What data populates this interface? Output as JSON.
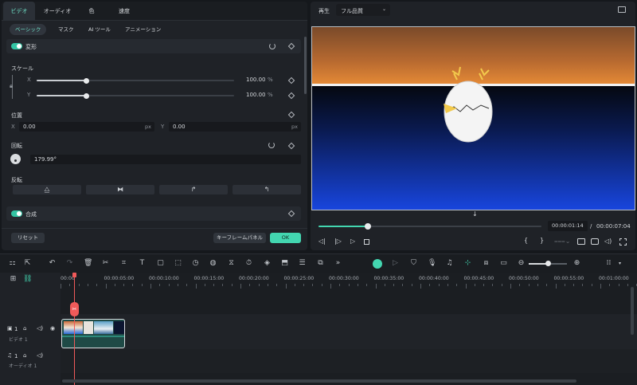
{
  "colors": {
    "accent": "#43d6b0",
    "playhead": "#f05a5a",
    "sky_top": "#7a4a2a",
    "sky_bottom": "#e58a36",
    "sea_top": "#050810",
    "sea_bottom": "#1846e0"
  },
  "left_panel": {
    "tabs": [
      "ビデオ",
      "オーディオ",
      "色",
      "速度"
    ],
    "active_tab": "ビデオ",
    "subtabs": [
      "ベーシック",
      "マスク",
      "AI ツール",
      "アニメーション"
    ],
    "active_subtab": "ベーシック",
    "transform": {
      "title": "変形",
      "scale_label": "スケール",
      "x_axis": "X",
      "y_axis": "Y",
      "scale_x": "100.00",
      "scale_y": "100.00",
      "percent": "%",
      "scale_x_level": 0.25,
      "scale_y_level": 0.25
    },
    "position": {
      "label": "位置",
      "x_label": "X",
      "x_value": "0.00",
      "y_label": "Y",
      "y_value": "0.00",
      "unit": "px"
    },
    "rotation": {
      "label": "回転",
      "value": "179.99°"
    },
    "flip": {
      "label": "反転",
      "icons": [
        "flip-horizontal-icon",
        "flip-vertical-icon",
        "rotate-right-icon",
        "rotate-left-icon"
      ],
      "glyphs": [
        "⧋",
        "⧓",
        "↱",
        "↰"
      ]
    },
    "composite": {
      "title": "合成"
    },
    "footer": {
      "reset": "リセット",
      "keyframe_panel": "キーフレームパネル",
      "ok": "OK"
    }
  },
  "preview": {
    "play_label": "再生",
    "quality": "フル品質",
    "current_time": "00:00:01:14",
    "separator": "/",
    "total_time": "00:00:07:04",
    "progress": 0.22
  },
  "timeline": {
    "ruler": [
      "00:00",
      "00:00:05:00",
      "00:00:10:00",
      "00:00:15:00",
      "00:00:20:00",
      "00:00:25:00",
      "00:00:30:00",
      "00:00:35:00",
      "00:00:40:00",
      "00:00:45:00",
      "00:00:50:00",
      "00:00:55:00",
      "00:01:00:00"
    ],
    "video_track": {
      "number": "1",
      "name": "ビデオ 1"
    },
    "audio_track": {
      "number": "1",
      "name": "オーディオ 1"
    }
  }
}
